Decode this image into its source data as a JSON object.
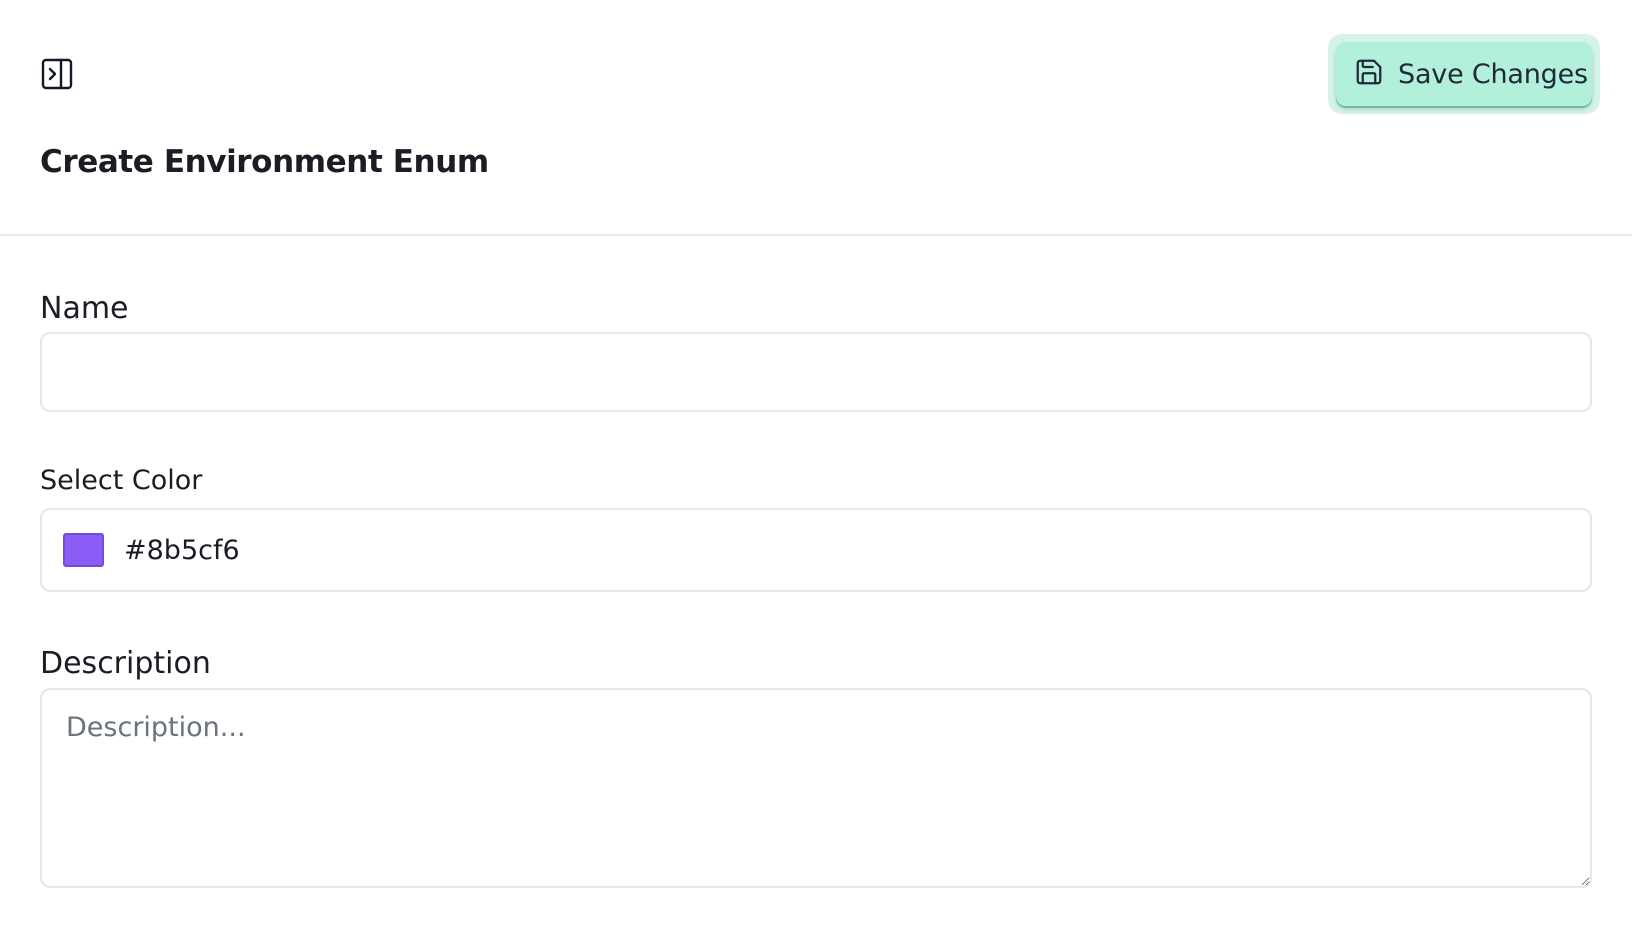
{
  "header": {
    "panel_toggle_icon": "panel-expand-icon",
    "save_button": {
      "label": "Save Changes",
      "icon": "save-icon",
      "background": "#b3f0dc"
    }
  },
  "form": {
    "title": "Create Environment Enum",
    "name": {
      "label": "Name",
      "value": ""
    },
    "color": {
      "label": "Select Color",
      "value": "#8b5cf6"
    },
    "description": {
      "label": "Description",
      "placeholder": "Description...",
      "value": ""
    }
  }
}
